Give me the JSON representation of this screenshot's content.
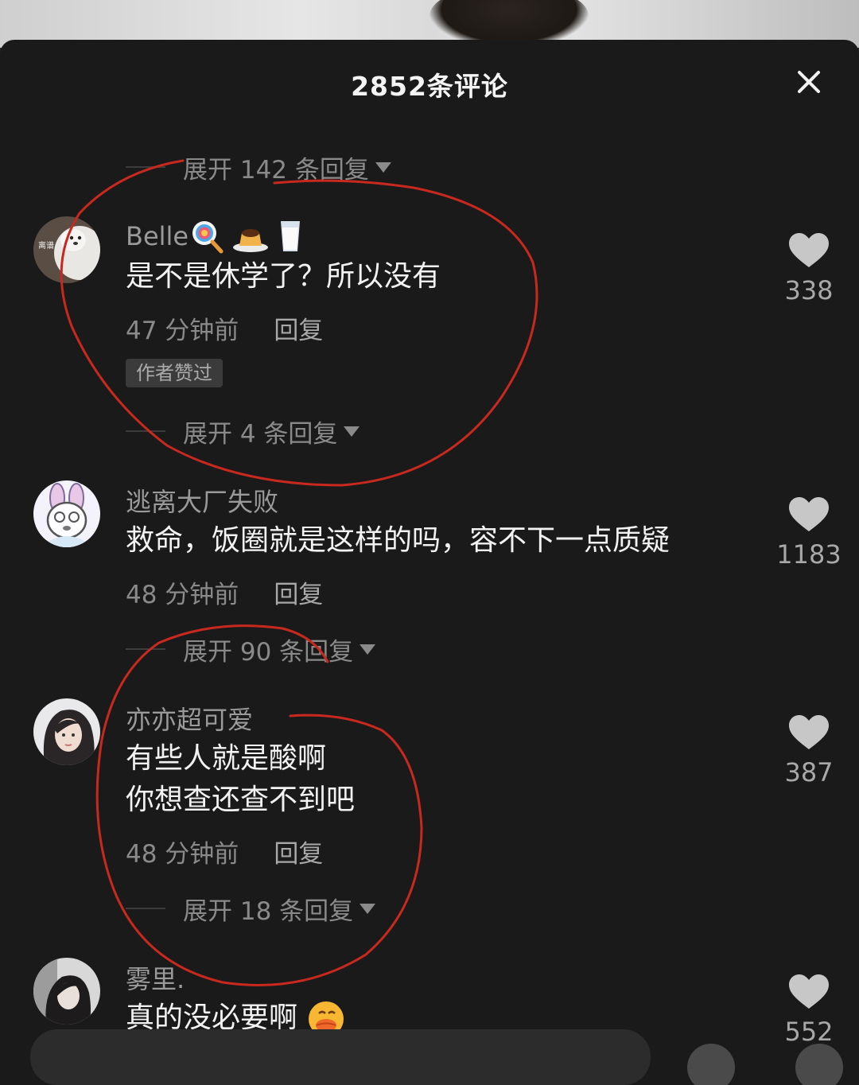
{
  "header": {
    "title": "2852条评论"
  },
  "threads": [
    {
      "expand_label": "展开 142 条回复"
    }
  ],
  "comments": [
    {
      "username": "Belle",
      "text_lines": [
        "是不是休学了？所以没有"
      ],
      "time": "47 分钟前",
      "reply_label": "回复",
      "badge": "作者赞过",
      "likes": "338",
      "expand_label": "展开 4 条回复",
      "avatar_text": "离谱"
    },
    {
      "username": "逃离大厂失败",
      "text_lines": [
        "救命，饭圈就是这样的吗，容不下一点质疑"
      ],
      "time": "48 分钟前",
      "reply_label": "回复",
      "likes": "1183",
      "expand_label": "展开 90 条回复"
    },
    {
      "username": "亦亦超可爱",
      "text_lines": [
        "有些人就是酸啊",
        "你想查还查不到吧"
      ],
      "time": "48 分钟前",
      "reply_label": "回复",
      "likes": "387",
      "expand_label": "展开 18 条回复"
    },
    {
      "username": "雾里.",
      "text_lines": [
        "真的没必要啊"
      ],
      "likes": "552"
    }
  ],
  "icons": {
    "close": "close-icon",
    "like": "heart-icon",
    "expand": "caret-down-icon",
    "username_emoji": [
      "lollipop-icon",
      "pudding-icon",
      "milk-glass-icon"
    ],
    "comment_emoji": "duck-face-icon"
  },
  "colors": {
    "sheet_bg": "#1a1a1a",
    "annotation_red": "#c8291f",
    "secondary_text": "#8a8a8a"
  }
}
